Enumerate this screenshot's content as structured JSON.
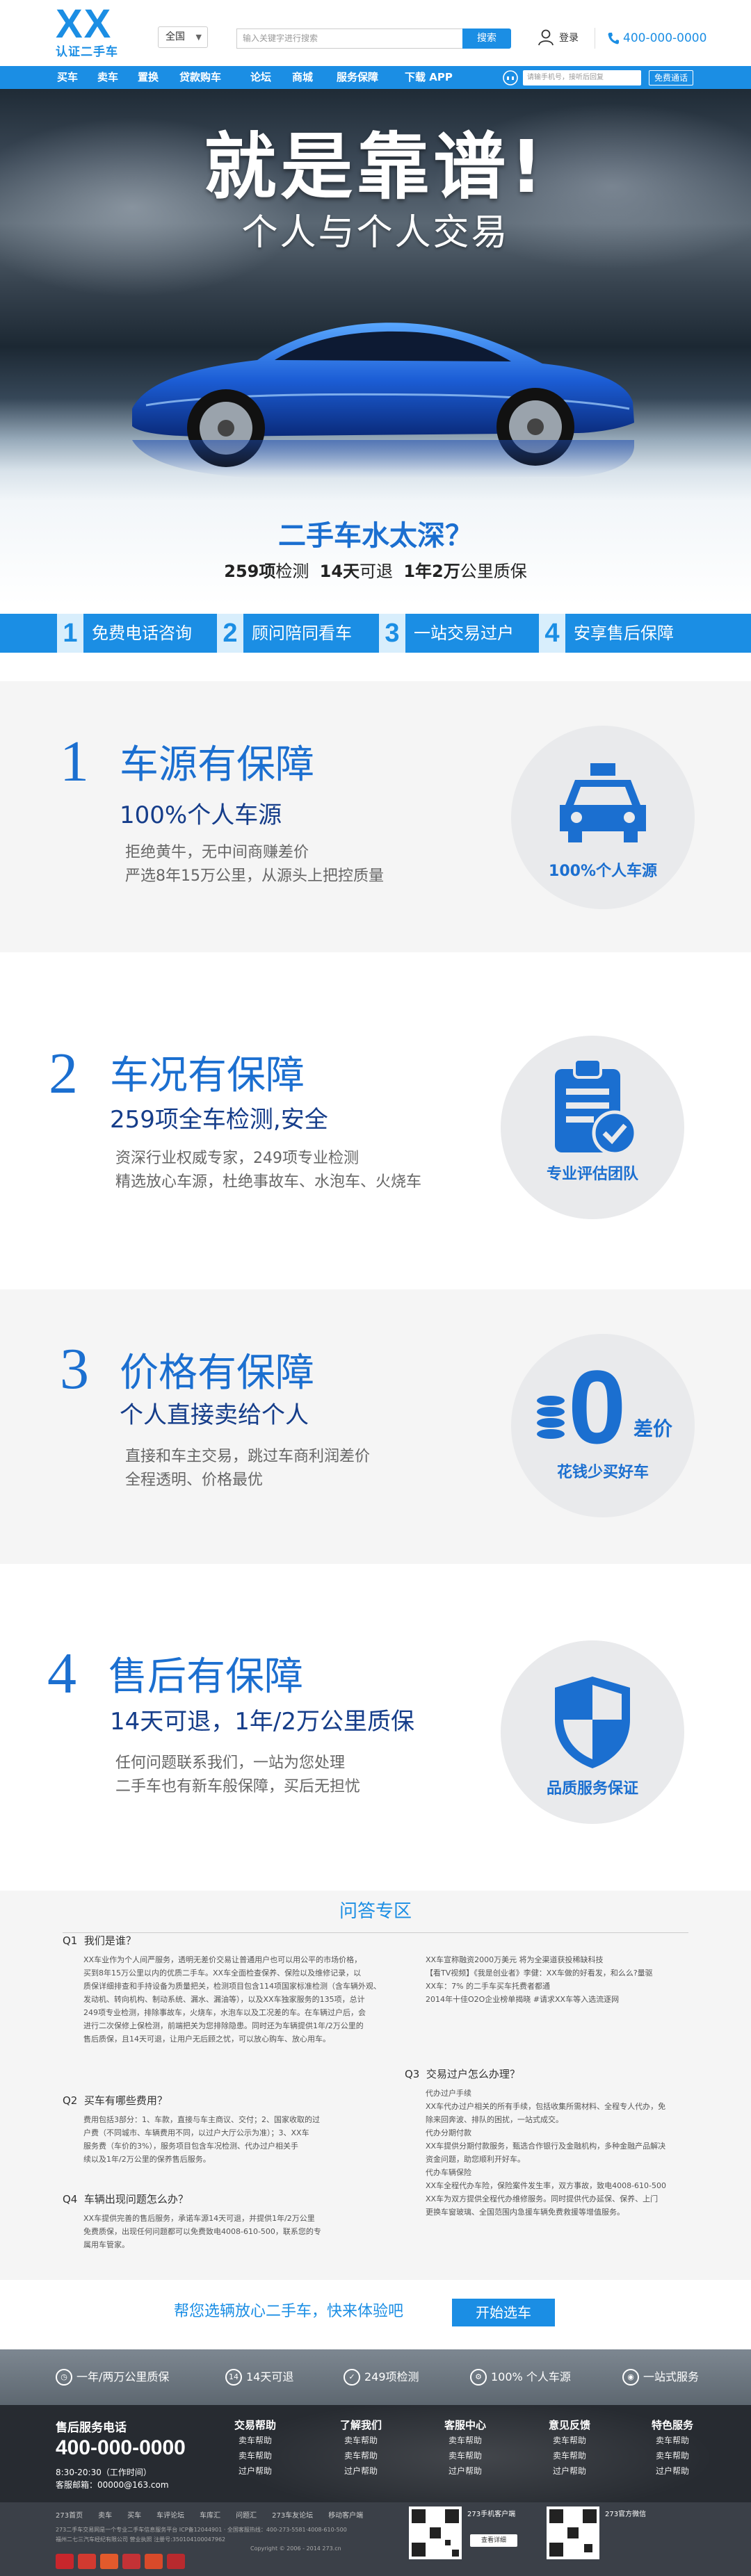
{
  "header": {
    "logo": "XX",
    "logo_sub": "认证二手车",
    "city": "全国",
    "search_placeholder": "输入关键字进行搜索",
    "search_button": "搜索",
    "login": "登录",
    "phone": "400-000-0000"
  },
  "nav": {
    "items": [
      "买车",
      "卖车",
      "置换",
      "贷款购车",
      "论坛",
      "商城",
      "服务保障",
      "下载 APP"
    ],
    "phone_placeholder": "请输手机号，接听后回复",
    "free_button": "免费通话"
  },
  "hero": {
    "title": "就是靠谱!",
    "subtitle": "个人与个人交易",
    "question": "二手车水太深？",
    "stat1_num": "259项",
    "stat1_txt": "检测",
    "stat2_num": "14天",
    "stat2_txt": "可退",
    "stat3_num": "1年2万",
    "stat3_txt": "公里质保"
  },
  "steps": [
    {
      "num": "1",
      "label": "免费电话咨询"
    },
    {
      "num": "2",
      "label": "顾问陪同看车"
    },
    {
      "num": "3",
      "label": "一站交易过户"
    },
    {
      "num": "4",
      "label": "安享售后保障"
    }
  ],
  "sections": [
    {
      "num": "1",
      "title": "车源有保障",
      "subtitle": "100%个人车源",
      "line1": "拒绝黄牛，无中间商赚差价",
      "line2": "严选8年15万公里，从源头上把控质量",
      "badge": "100%个人车源",
      "icon": "car-icon"
    },
    {
      "num": "2",
      "title": "车况有保障",
      "subtitle": "259项全车检测,安全",
      "line1": "资深行业权威专家，249项专业检测",
      "line2": "精选放心车源，杜绝事故车、水泡车、火烧车",
      "badge": "专业评估团队",
      "icon": "clipboard-check-icon"
    },
    {
      "num": "3",
      "title": "价格有保障",
      "subtitle": "个人直接卖给个人",
      "line1": "直接和车主交易，跳过车商利润差价",
      "line2": "全程透明、价格最优",
      "badge": "花钱少买好车",
      "zero": "0",
      "zero_suffix": "差价",
      "icon": "coins-icon"
    },
    {
      "num": "4",
      "title": "售后有保障",
      "subtitle": "14天可退，1年/2万公里质保",
      "line1": "任何问题联系我们，一站为您处理",
      "line2": "二手车也有新车般保障，买后无担忧",
      "badge": "品质服务保证",
      "icon": "shield-icon"
    }
  ],
  "faq": {
    "title": "问答专区",
    "q1": {
      "label": "Q1",
      "question": "我们是谁？",
      "answer": "XX车业作为个人间严服务，透明无差价交易让普通用户也可以用公平的市场价格，\n买到8年15万公里以内的优质二手车。XX车全面检查保养、保险以及维修记录，以\n质保详细排查和手持设备为质量把关，检测项目包含114项国家标准检测（含车辆外观、\n发动机、转向机构、制动系统、漏水、漏油等），以及XX车独家服务的135项，总计\n249项专业检测，排除事故车，火烧车，水泡车以及工况差的车。在车辆过户后，会\n进行二次保修上保检测，前端把关为您排除隐患。同时还为车辆提供1年/2万公里的\n售后质保，且14天可退，让用户无后顾之忧，可以放心购车、放心用车。"
    },
    "q2": {
      "label": "Q2",
      "question": "买车有哪些费用？",
      "answer": "费用包括3部分：1、车款，直接与车主商议、交付；2、国家收取的过\n户费（不同城市、车辆费用不同，以过户大厅公示为准）；3、XX车\n服务费（车价的3%），服务项目包含车况检测、代办过户相关手\n续以及1年/2万公里的保养售后服务。"
    },
    "q3": {
      "label": "Q3",
      "question": "交易过户怎么办理？",
      "answer": "代办过户手续\nXX车代办过户相关的所有手续，包括收集所需材料、全程专人代办，免\n除来回奔波、排队的困扰，一站式成交。\n代办分期付款\nXX车提供分期付款服务，甄选合作银行及金融机构，多种金融产品解决\n资金问题，助您顺利开好车。\n代办车辆保险\nXX车全程代办车险，保险案件发生率，双方事故，致电4008-610-500\nXX车为双方提供全程代办维修服务。同时提供代办延保、保养、上门\n更换车窗玻璃、全国范围内急援车辆免费救援等增值服务。"
    },
    "q4": {
      "label": "Q4",
      "question": "车辆出现问题怎么办？",
      "answer": "XX车提供完善的售后服务，承诺车源14天可退，并提供1年/2万公里\n免费质保，出现任何问题都可以免费致电4008-610-500，联系您的专\n属用车管家。"
    },
    "about": "XX车宣称融资2000万美元 将为全渠道获投稀缺科技\n【看TV视频】《我是创业者》李健：XX车做的好看发，和么么?量驱\nXX车：7% 的二手车买车托费者都通\n2014年十佳O2O企业榜单揭晓 #请求XX车等入选流逐网"
  },
  "cta": {
    "text": "帮您选辆放心二手车，快来体验吧",
    "button": "开始选车"
  },
  "features": [
    "一年/两万公里质保",
    "14天可退",
    "249项检测",
    "100% 个人车源",
    "一站式服务"
  ],
  "footer": {
    "service_title": "售后服务电话",
    "service_phone": "400-000-0000",
    "hours": "8:30-20:30（工作时间）",
    "email": "客服邮箱：00000@163.com",
    "cols": [
      {
        "title": "交易帮助",
        "items": [
          "卖车帮助",
          "卖车帮助",
          "过户帮助"
        ]
      },
      {
        "title": "了解我们",
        "items": [
          "卖车帮助",
          "卖车帮助",
          "过户帮助"
        ]
      },
      {
        "title": "客服中心",
        "items": [
          "卖车帮助",
          "卖车帮助",
          "过户帮助"
        ]
      },
      {
        "title": "意见反馈",
        "items": [
          "卖车帮助",
          "卖车帮助",
          "过户帮助"
        ]
      },
      {
        "title": "特色服务",
        "items": [
          "卖车帮助",
          "卖车帮助",
          "过户帮助"
        ]
      }
    ],
    "links": [
      "273首页",
      "卖车",
      "买车",
      "车评论坛",
      "车库汇",
      "问题汇",
      "273车友论坛",
      "移动客户端"
    ],
    "copy1": "273二手车交易网是一个专业二手车信息服务平台 ICP备12044901 · 全国客服热线：400-273-5581·4008-610-500",
    "copy2": "福州二七三汽车经纪有限公司 营业执照 注册号:350104100047962",
    "copy3": "Copyright © 2006 - 2014 273.cn",
    "qr1_title": "273手机客户端",
    "qr1_btn": "查看详细",
    "qr2_title": "273官方微信"
  },
  "colors": {
    "brand": "#1b8ee4",
    "dark_blue": "#1b6fd0",
    "navy": "#153d8a"
  }
}
